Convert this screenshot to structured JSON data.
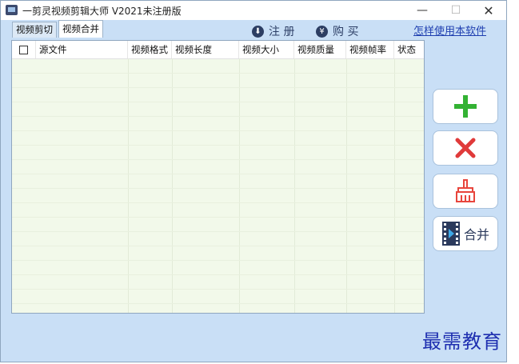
{
  "window": {
    "title": "一剪灵视频剪辑大师 V2021未注册版",
    "minimize_glyph": "—",
    "maximize_glyph": "☐",
    "close_glyph": "✕"
  },
  "tabs": [
    {
      "label": "视频剪切",
      "active": false
    },
    {
      "label": "视频合并",
      "active": true
    }
  ],
  "top_actions": {
    "register_label": "注 册",
    "buy_label": "购 买",
    "help_link": "怎样使用本软件",
    "register_icon": "download-circle-icon",
    "buy_icon": "coin-circle-icon"
  },
  "table": {
    "columns": [
      "源文件",
      "视频格式",
      "视频长度",
      "视频大小",
      "视频质量",
      "视频帧率",
      "状态"
    ],
    "rows": []
  },
  "side_buttons": {
    "add_icon": "plus-icon",
    "delete_icon": "x-icon",
    "clear_icon": "broom-icon",
    "merge_icon": "film-play-icon",
    "merge_label": "合并"
  },
  "colors": {
    "window_bg": "#c9dff6",
    "table_bg": "#f2f9ea",
    "add_green": "#33b233",
    "delete_red": "#e03a3a",
    "clear_red": "#e8453c",
    "link_blue": "#1f3fb0"
  },
  "watermark": "最需教育"
}
